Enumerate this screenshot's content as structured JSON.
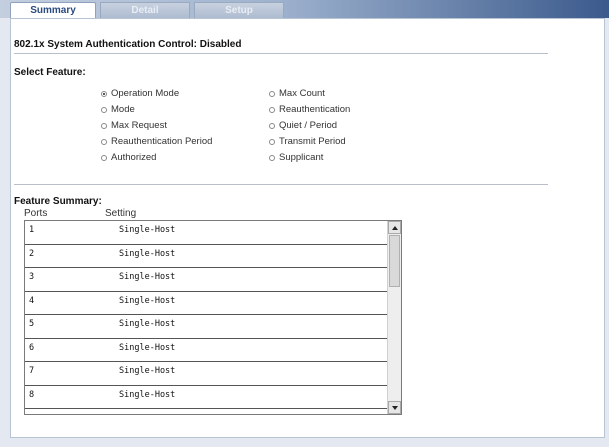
{
  "tabs": [
    {
      "label": "Summary",
      "active": true
    },
    {
      "label": "Detail",
      "active": false
    },
    {
      "label": "Setup",
      "active": false
    }
  ],
  "status_title": "802.1x System Authentication Control: Disabled",
  "select_feature": {
    "heading": "Select Feature:",
    "options_left": [
      "Operation Mode",
      "Mode",
      "Max Request",
      "Reauthentication Period",
      "Authorized"
    ],
    "options_right": [
      "Max Count",
      "Reauthentication",
      "Quiet / Period",
      "Transmit Period",
      "Supplicant"
    ],
    "selected": "Operation Mode"
  },
  "feature_summary": {
    "heading": "Feature Summary:",
    "columns": [
      "Ports",
      "Setting"
    ],
    "rows": [
      {
        "port": "1",
        "setting": "Single-Host"
      },
      {
        "port": "2",
        "setting": "Single-Host"
      },
      {
        "port": "3",
        "setting": "Single-Host"
      },
      {
        "port": "4",
        "setting": "Single-Host"
      },
      {
        "port": "5",
        "setting": "Single-Host"
      },
      {
        "port": "6",
        "setting": "Single-Host"
      },
      {
        "port": "7",
        "setting": "Single-Host"
      },
      {
        "port": "8",
        "setting": "Single-Host"
      }
    ]
  },
  "icons": {
    "scroll_up": "scroll-up-arrow-icon",
    "scroll_down": "scroll-down-arrow-icon",
    "radio_selected": "radio-selected-icon",
    "radio_unselected": "radio-unselected-icon"
  },
  "colors": {
    "tab_active_text": "#2a4a80",
    "tabbar_dark": "#3b5a8c",
    "page_background": "#e4e9f1"
  }
}
